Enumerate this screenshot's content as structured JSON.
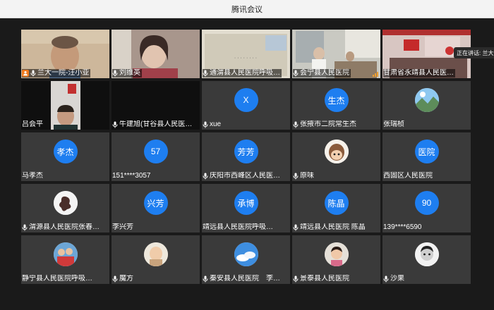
{
  "window": {
    "title": "腾讯会议"
  },
  "speaking": {
    "label": "正在讲话: 兰大一"
  },
  "tiles": [
    {
      "name": "兰大一院-汪小亚",
      "type": "video",
      "host": true,
      "mic": true,
      "scene": "face-man",
      "bg": "#c7b59a"
    },
    {
      "name": "刘维英",
      "type": "video",
      "host": false,
      "mic": true,
      "scene": "face-woman",
      "bg": "#9f8f85"
    },
    {
      "name": "通渭县人民医院呼吸…",
      "type": "video",
      "host": false,
      "mic": true,
      "scene": "sign",
      "bg": "#d8d3c6"
    },
    {
      "name": "会宁县人民医院",
      "type": "video",
      "host": false,
      "mic": true,
      "scene": "office",
      "bg": "#b5b6b0",
      "signal": true
    },
    {
      "name": "甘肃省永靖县人民医…",
      "type": "video",
      "host": false,
      "mic": false,
      "scene": "room",
      "bg": "#c9b4ae"
    },
    {
      "name": "吕会平",
      "type": "video-narrow",
      "host": false,
      "mic": false,
      "scene": "person-small",
      "bg": "#0f0f0f"
    },
    {
      "name": "牛建旭(甘谷县人民医…",
      "type": "black",
      "host": false,
      "mic": true
    },
    {
      "name": "xue",
      "type": "avatar",
      "avatar_text": "X",
      "host": false,
      "mic": true
    },
    {
      "name": "张掖市二院常生杰",
      "type": "avatar",
      "avatar_text": "生杰",
      "host": false,
      "mic": true
    },
    {
      "name": "张瑞桢",
      "type": "avatar-img",
      "img": "sky",
      "host": false,
      "mic": false
    },
    {
      "name": "马孝杰",
      "type": "avatar",
      "avatar_text": "孝杰",
      "host": false,
      "mic": false
    },
    {
      "name": "151****3057",
      "type": "avatar",
      "avatar_text": "57",
      "host": false,
      "mic": false
    },
    {
      "name": "庆阳市西峰区人民医…",
      "type": "avatar",
      "avatar_text": "芳芳",
      "host": false,
      "mic": true
    },
    {
      "name": "原味",
      "type": "avatar-img",
      "img": "cartoon",
      "host": false,
      "mic": true
    },
    {
      "name": "西固区人民医院",
      "type": "avatar",
      "avatar_text": "医院",
      "host": false,
      "mic": false
    },
    {
      "name": "渭源县人民医院张春…",
      "type": "avatar-img",
      "img": "flower",
      "host": false,
      "mic": true
    },
    {
      "name": "李兴芳",
      "type": "avatar",
      "avatar_text": "兴芳",
      "host": false,
      "mic": false
    },
    {
      "name": "靖远县人民医院呼吸…",
      "type": "avatar",
      "avatar_text": "承博",
      "host": false,
      "mic": false
    },
    {
      "name": "靖远县人民医院 陈晶",
      "type": "avatar",
      "avatar_text": "陈晶",
      "host": false,
      "mic": true
    },
    {
      "name": "139****6590",
      "type": "avatar",
      "avatar_text": "90",
      "host": false,
      "mic": false
    },
    {
      "name": "静宁县人民医院呼吸…",
      "type": "avatar-img",
      "img": "kids",
      "host": false,
      "mic": false
    },
    {
      "name": "魔方",
      "type": "avatar-img",
      "img": "baby",
      "host": false,
      "mic": true
    },
    {
      "name": "秦安县人民医院　李…",
      "type": "avatar-img",
      "img": "clouds",
      "host": false,
      "mic": true
    },
    {
      "name": "景泰县人民医院",
      "type": "avatar-img",
      "img": "kid2",
      "host": false,
      "mic": true
    },
    {
      "name": "沙果",
      "type": "avatar-img",
      "img": "face-bw",
      "host": false,
      "mic": true
    }
  ]
}
